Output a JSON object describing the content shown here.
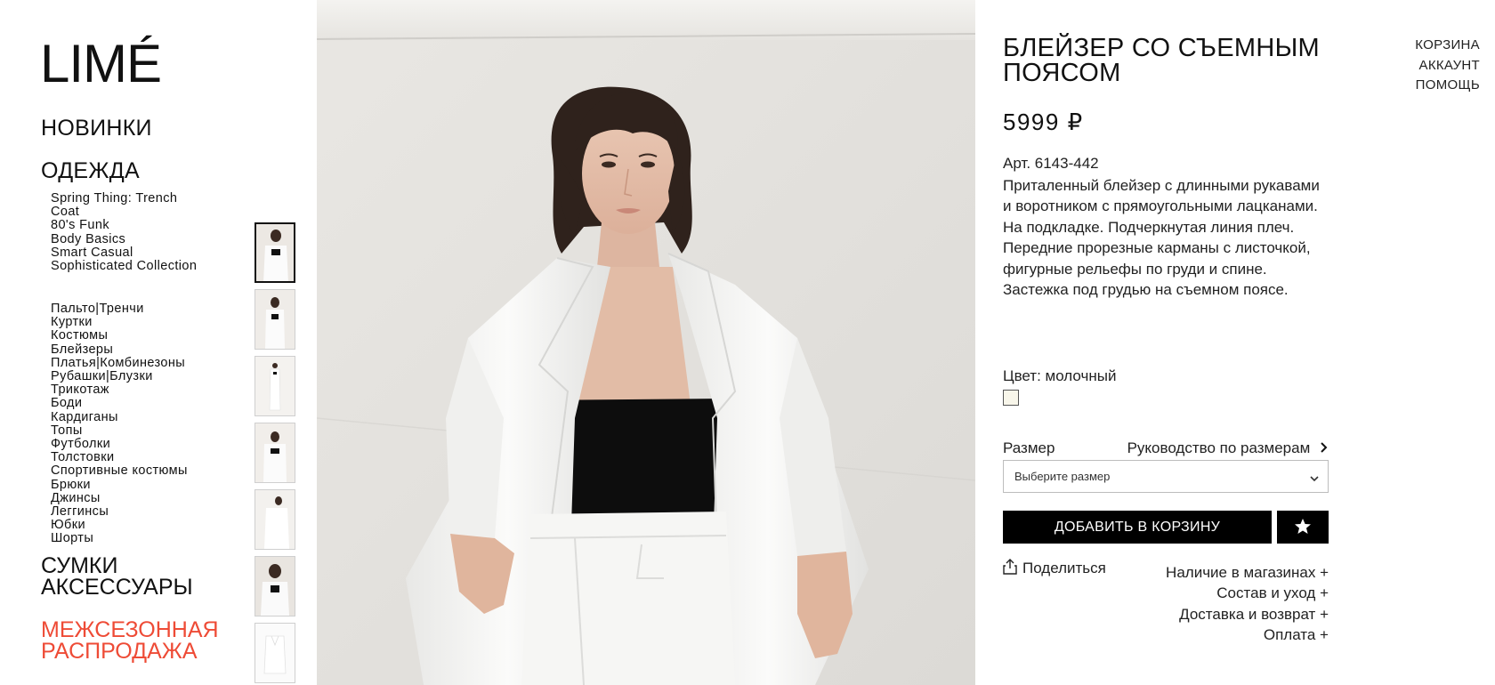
{
  "brand": {
    "logo_text": "LIMÉ"
  },
  "nav": {
    "new": "НОВИНКИ",
    "clothes": "ОДЕЖДА",
    "collections": [
      "Spring Thing: Trench Coat",
      "80's Funk",
      "Body Basics",
      "Smart Casual",
      "Sophisticated Collection"
    ],
    "categories": [
      "Пальто|Тренчи",
      "Куртки",
      "Костюмы",
      "Блейзеры",
      "Платья|Комбинезоны",
      "Рубашки|Блузки",
      "Трикотаж",
      "Боди",
      "Кардиганы",
      "Топы",
      "Футболки",
      "Толстовки",
      "Спортивные костюмы",
      "Брюки",
      "Джинсы",
      "Леггинсы",
      "Юбки",
      "Шорты"
    ],
    "bags": "СУМКИ",
    "accessories": "АКСЕССУАРЫ",
    "sale_line1": "МЕЖСЕЗОННАЯ",
    "sale_line2": "РАСПРОДАЖА"
  },
  "top_links": {
    "cart": "КОРЗИНА",
    "account": "АККАУНТ",
    "help": "ПОМОЩЬ"
  },
  "product": {
    "title": "БЛЕЙЗЕР СО СЪЕМНЫМ ПОЯСОМ",
    "price": "5999 ₽",
    "article": "Арт. 6143-442",
    "description": "Приталенный блейзер с длинными рукавами и воротником с прямоугольными лацканами. На подкладке. Подчеркнутая линия плеч. Передние прорезные карманы с листочкой, фигурные рельефы по груди и спине. Застежка под грудью на съемном поясе.",
    "color_label": "Цвет: молочный",
    "color_hex": "#f8f6ea",
    "size_label": "Размер",
    "size_guide": "Руководство по размерам",
    "size_placeholder": "Выберите размер",
    "add_to_cart": "ДОБАВИТЬ В КОРЗИНУ",
    "share": "Поделиться",
    "accordions": [
      "Наличие в магазинах +",
      "Состав и уход +",
      "Доставка и возврат +",
      "Оплата +"
    ]
  },
  "colors": {
    "sale": "#ee4b36",
    "button": "#000000"
  }
}
